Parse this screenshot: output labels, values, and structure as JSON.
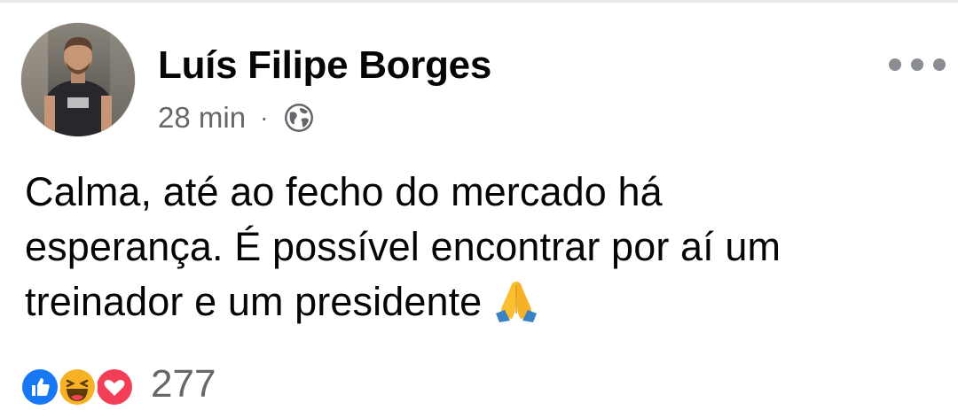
{
  "post": {
    "author": "Luís Filipe Borges",
    "timestamp": "28 min",
    "separator": "·",
    "privacy_icon": "globe-icon",
    "text_lines": [
      "Calma, até ao fecho do mercado há",
      "esperança. É possível encontrar por aí um",
      "treinador e um presidente"
    ],
    "emoji": "folded-hands-emoji",
    "reactions": {
      "types": [
        "like",
        "haha",
        "love"
      ],
      "count": "277"
    }
  },
  "colors": {
    "text_primary": "#050505",
    "text_secondary": "#65676b",
    "like_blue": "#1877f2",
    "haha_yellow": "#f7b125",
    "love_red": "#f33e58"
  }
}
